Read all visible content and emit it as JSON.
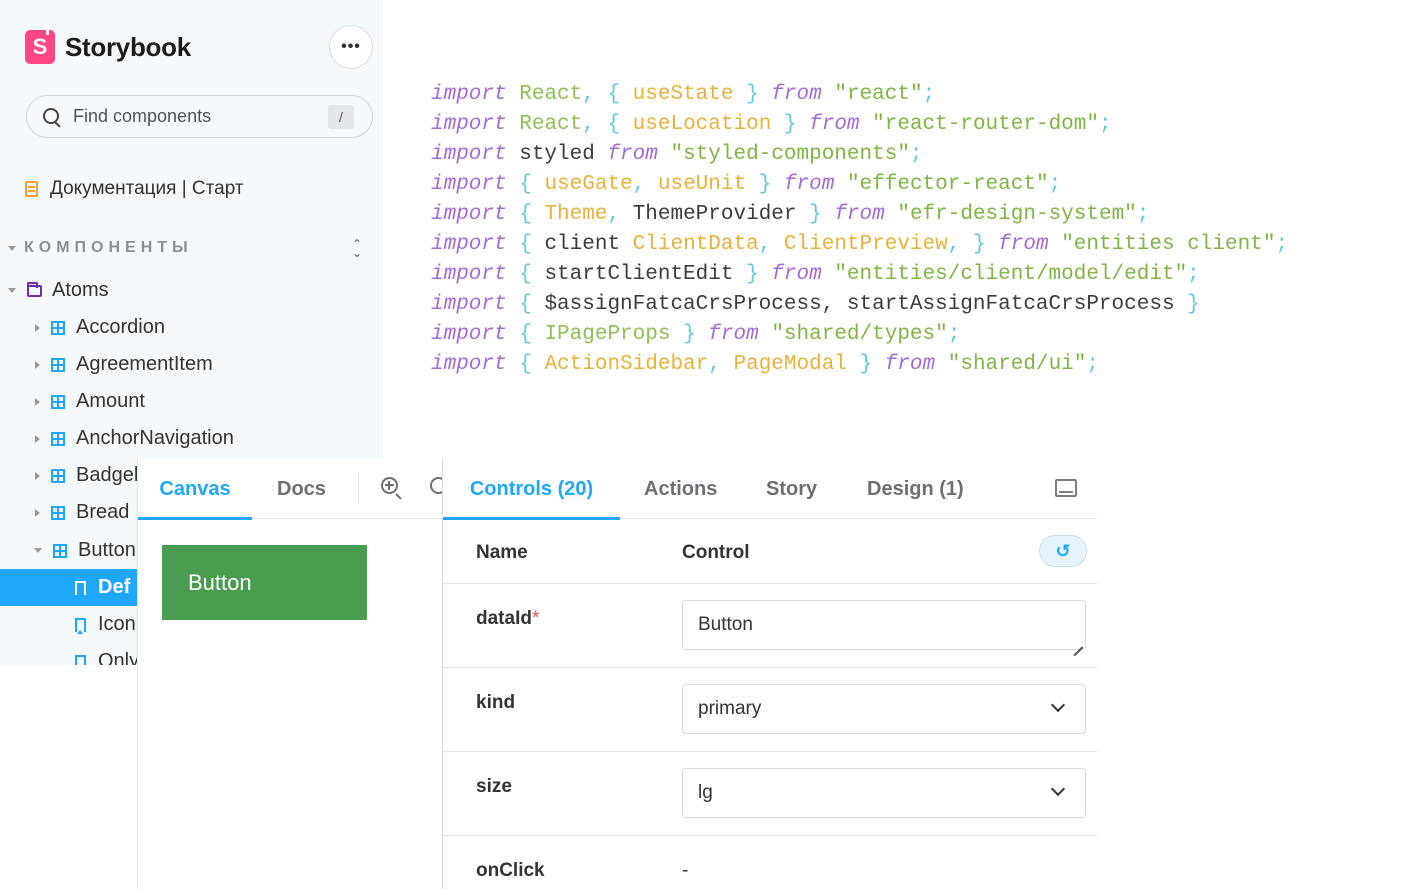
{
  "sidebar": {
    "logo_letter": "S",
    "app_name": "Storybook",
    "menu_label": "•••",
    "search": {
      "placeholder": "Find components",
      "shortcut": "/"
    },
    "doc_item": "Документация | Старт",
    "section_label": "КОМПОНЕНТЫ",
    "tree": [
      {
        "label": "Atoms",
        "kind": "folder"
      },
      {
        "label": "Accordion",
        "kind": "component"
      },
      {
        "label": "AgreementItem",
        "kind": "component"
      },
      {
        "label": "Amount",
        "kind": "component"
      },
      {
        "label": "AnchorNavigation",
        "kind": "component"
      },
      {
        "label": "Badgel",
        "kind": "component"
      },
      {
        "label": "Bread",
        "kind": "component"
      },
      {
        "label": "Button",
        "kind": "component"
      },
      {
        "label": "Def",
        "kind": "story",
        "selected": true
      },
      {
        "label": "Icon",
        "kind": "story"
      },
      {
        "label": "Only",
        "kind": "story"
      }
    ]
  },
  "code": {
    "lines": [
      [
        [
          "kw",
          "import"
        ],
        [
          "tx",
          " "
        ],
        [
          "id",
          "React"
        ],
        [
          "pn",
          ", { "
        ],
        [
          "fn",
          "useState"
        ],
        [
          "pn",
          " } "
        ],
        [
          "kw",
          "from"
        ],
        [
          "tx",
          " "
        ],
        [
          "str",
          "\"react\""
        ],
        [
          "pn",
          ";"
        ]
      ],
      [
        [
          "kw",
          "import"
        ],
        [
          "tx",
          " "
        ],
        [
          "id",
          "React"
        ],
        [
          "pn",
          ", { "
        ],
        [
          "fn",
          "useLocation"
        ],
        [
          "pn",
          " } "
        ],
        [
          "kw",
          "from"
        ],
        [
          "tx",
          " "
        ],
        [
          "str",
          "\"react-router-dom\""
        ],
        [
          "pn",
          ";"
        ]
      ],
      [
        [
          "kw",
          "import"
        ],
        [
          "tx",
          " styled "
        ],
        [
          "kw",
          "from"
        ],
        [
          "tx",
          " "
        ],
        [
          "str",
          "\"styled-components\""
        ],
        [
          "pn",
          ";"
        ]
      ],
      [
        [
          "kw",
          "import"
        ],
        [
          "pn",
          " { "
        ],
        [
          "fn",
          "useGate"
        ],
        [
          "pn",
          ", "
        ],
        [
          "fn",
          "useUnit"
        ],
        [
          "pn",
          " } "
        ],
        [
          "kw",
          "from"
        ],
        [
          "tx",
          " "
        ],
        [
          "str",
          "\"effector-react\""
        ],
        [
          "pn",
          ";"
        ]
      ],
      [
        [
          "kw",
          "import"
        ],
        [
          "pn",
          " { "
        ],
        [
          "fn",
          "Theme"
        ],
        [
          "pn",
          ", "
        ],
        [
          "tx",
          "ThemeProvider"
        ],
        [
          "pn",
          " } "
        ],
        [
          "kw",
          "from"
        ],
        [
          "tx",
          " "
        ],
        [
          "str",
          "\"efr-design-system\""
        ],
        [
          "pn",
          ";"
        ]
      ],
      [
        [
          "kw",
          "import"
        ],
        [
          "pn",
          " { "
        ],
        [
          "tx",
          "client "
        ],
        [
          "fn",
          "ClientData"
        ],
        [
          "pn",
          ", "
        ],
        [
          "fn",
          "ClientPreview"
        ],
        [
          "pn",
          ", } "
        ],
        [
          "kw",
          "from"
        ],
        [
          "tx",
          " "
        ],
        [
          "str",
          "\"entities client\""
        ],
        [
          "pn",
          ";"
        ]
      ],
      [
        [
          "kw",
          "import"
        ],
        [
          "pn",
          " { "
        ],
        [
          "tx",
          "startClientEdit"
        ],
        [
          "pn",
          " } "
        ],
        [
          "kw",
          "from"
        ],
        [
          "tx",
          " "
        ],
        [
          "str",
          "\"entities/client/model/edit\""
        ],
        [
          "pn",
          ";"
        ]
      ],
      [
        [
          "kw",
          "import"
        ],
        [
          "pn",
          " { "
        ],
        [
          "tx",
          "$assignFatcaCrsProcess, startAssignFatcaCrsProcess"
        ],
        [
          "pn",
          " }"
        ]
      ],
      [
        [
          "kw",
          "import"
        ],
        [
          "pn",
          " { "
        ],
        [
          "id",
          "IPageProps"
        ],
        [
          "pn",
          " } "
        ],
        [
          "kw",
          "from"
        ],
        [
          "tx",
          " "
        ],
        [
          "str",
          "\"shared/types\""
        ],
        [
          "pn",
          ";"
        ]
      ],
      [
        [
          "kw",
          "import"
        ],
        [
          "pn",
          " { "
        ],
        [
          "fn",
          "ActionSidebar"
        ],
        [
          "pn",
          ", "
        ],
        [
          "fn",
          "PageModal"
        ],
        [
          "pn",
          " } "
        ],
        [
          "kw",
          "from"
        ],
        [
          "tx",
          " "
        ],
        [
          "str",
          "\"shared/ui\""
        ],
        [
          "pn",
          ";"
        ]
      ]
    ]
  },
  "canvas": {
    "tabs": [
      {
        "label": "Canvas",
        "active": true
      },
      {
        "label": "Docs",
        "active": false
      }
    ],
    "preview_button_label": "Button"
  },
  "addons": {
    "tabs": [
      {
        "label": "Controls (20)",
        "active": true
      },
      {
        "label": "Actions",
        "active": false
      },
      {
        "label": "Story",
        "active": false
      },
      {
        "label": "Design (1)",
        "active": false
      }
    ],
    "header": {
      "name": "Name",
      "control": "Control",
      "reset_icon": "↺"
    },
    "rows": [
      {
        "name": "dataId",
        "required": "*",
        "type": "text",
        "value": "Button"
      },
      {
        "name": "kind",
        "type": "select",
        "value": "primary"
      },
      {
        "name": "size",
        "type": "select",
        "value": "lg"
      },
      {
        "name": "onClick",
        "type": "none",
        "value": "-"
      }
    ]
  },
  "colors": {
    "accent": "#1ea7fd",
    "brand": "#ff4785",
    "preview_button": "#4a9d50",
    "sidebar_bg": "#f6f9fc"
  }
}
